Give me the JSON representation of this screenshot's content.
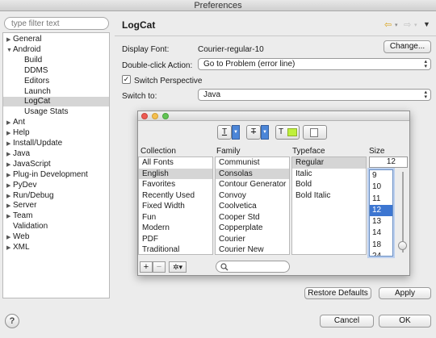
{
  "window": {
    "title": "Preferences"
  },
  "sidebar": {
    "filter_placeholder": "type filter text",
    "items": [
      {
        "label": "General",
        "arrow": "▶"
      },
      {
        "label": "Android",
        "arrow": "▼"
      },
      {
        "label": "Build",
        "arrow": ""
      },
      {
        "label": "DDMS",
        "arrow": ""
      },
      {
        "label": "Editors",
        "arrow": ""
      },
      {
        "label": "Launch",
        "arrow": ""
      },
      {
        "label": "LogCat",
        "arrow": ""
      },
      {
        "label": "Usage Stats",
        "arrow": ""
      },
      {
        "label": "Ant",
        "arrow": "▶"
      },
      {
        "label": "Help",
        "arrow": "▶"
      },
      {
        "label": "Install/Update",
        "arrow": "▶"
      },
      {
        "label": "Java",
        "arrow": "▶"
      },
      {
        "label": "JavaScript",
        "arrow": "▶"
      },
      {
        "label": "Plug-in Development",
        "arrow": "▶"
      },
      {
        "label": "PyDev",
        "arrow": "▶"
      },
      {
        "label": "Run/Debug",
        "arrow": "▶"
      },
      {
        "label": "Server",
        "arrow": "▶"
      },
      {
        "label": "Team",
        "arrow": "▶"
      },
      {
        "label": "Validation",
        "arrow": ""
      },
      {
        "label": "Web",
        "arrow": "▶"
      },
      {
        "label": "XML",
        "arrow": "▶"
      }
    ],
    "selected": "LogCat"
  },
  "page": {
    "title": "LogCat",
    "display_font_label": "Display Font:",
    "display_font_value": "Courier-regular-10",
    "change_button": "Change...",
    "double_click_label": "Double-click Action:",
    "double_click_value": "Go to Problem (error line)",
    "switch_perspective_label": "Switch Perspective",
    "switch_perspective_checked": true,
    "switch_to_label": "Switch to:",
    "switch_to_value": "Java",
    "restore_defaults": "Restore Defaults",
    "apply": "Apply"
  },
  "font_dialog": {
    "toolbar": {
      "text_color_glyph": "T",
      "strike_glyph": "T",
      "text_bg_glyph": "T",
      "doc_glyph": "▢"
    },
    "collection": {
      "header": "Collection",
      "items": [
        "All Fonts",
        "English",
        "Favorites",
        "Recently Used",
        "Fixed Width",
        "Fun",
        "Modern",
        "PDF",
        "Traditional"
      ],
      "selected": "English"
    },
    "family": {
      "header": "Family",
      "items": [
        "Communist",
        "Consolas",
        "Contour Generator",
        "Convoy",
        "Coolvetica",
        "Cooper Std",
        "Copperplate",
        "Courier",
        "Courier New"
      ],
      "selected": "Consolas"
    },
    "typeface": {
      "header": "Typeface",
      "items": [
        "Regular",
        "Italic",
        "Bold",
        "Bold Italic"
      ],
      "selected": "Regular"
    },
    "size": {
      "header": "Size",
      "value": "12",
      "items": [
        "9",
        "10",
        "11",
        "12",
        "13",
        "14",
        "18",
        "24"
      ],
      "selected": "12"
    },
    "add_button": "+",
    "remove_button": "−",
    "action_button": "✲▾"
  },
  "footer": {
    "help": "?",
    "cancel": "Cancel",
    "ok": "OK"
  },
  "colors": {
    "selection_blue": "#3d76d1",
    "selection_grey": "#d5d5d5",
    "toolbar_drop_blue": "#4c86d8",
    "swatch_green": "#bff03c",
    "close_red": "#ee5a52",
    "minimize_yellow": "#f5bf4f",
    "zoom_green": "#62c454"
  }
}
